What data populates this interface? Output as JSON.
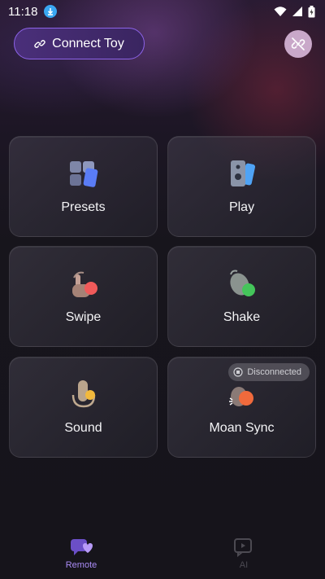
{
  "status_bar": {
    "time": "11:18"
  },
  "header": {
    "connect_label": "Connect Toy"
  },
  "cards": [
    {
      "label": "Presets",
      "icon": "presets-grid-icon"
    },
    {
      "label": "Play",
      "icon": "play-remote-icon"
    },
    {
      "label": "Swipe",
      "icon": "swipe-hand-icon"
    },
    {
      "label": "Shake",
      "icon": "shake-phone-icon"
    },
    {
      "label": "Sound",
      "icon": "sound-mic-icon"
    },
    {
      "label": "Moan Sync",
      "icon": "moan-sync-icon",
      "badge": "Disconnected"
    }
  ],
  "tabs": [
    {
      "label": "Remote",
      "icon": "remote-heart-icon",
      "active": true
    },
    {
      "label": "AI",
      "icon": "ai-chat-icon",
      "active": false
    }
  ],
  "colors": {
    "accent": "#8d63e8",
    "active_tab": "#a98bf5",
    "inactive_tab": "#4c4a52"
  }
}
